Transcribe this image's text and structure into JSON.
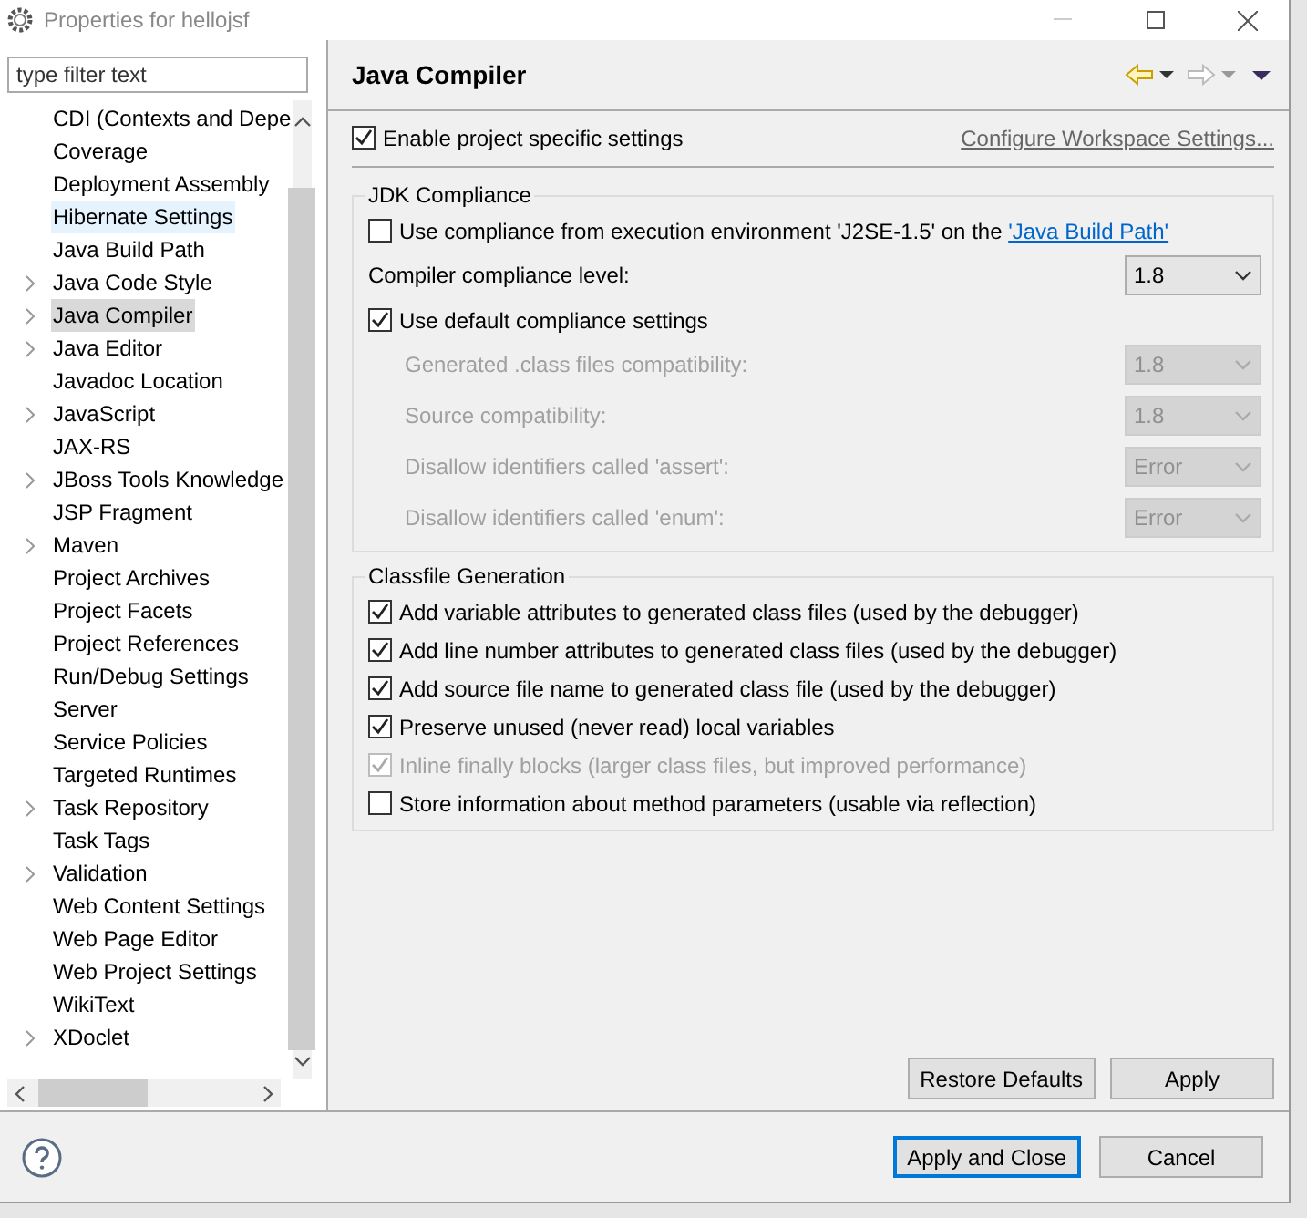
{
  "window": {
    "title": "Properties for hellojsf"
  },
  "filter": {
    "placeholder": "type filter text"
  },
  "tree": [
    {
      "label": "CDI (Contexts and Depe",
      "expandable": false,
      "selected": false,
      "hovered": false
    },
    {
      "label": "Coverage",
      "expandable": false,
      "selected": false,
      "hovered": false
    },
    {
      "label": "Deployment Assembly",
      "expandable": false,
      "selected": false,
      "hovered": false
    },
    {
      "label": "Hibernate Settings",
      "expandable": false,
      "selected": false,
      "hovered": true
    },
    {
      "label": "Java Build Path",
      "expandable": false,
      "selected": false,
      "hovered": false
    },
    {
      "label": "Java Code Style",
      "expandable": true,
      "selected": false,
      "hovered": false
    },
    {
      "label": "Java Compiler",
      "expandable": true,
      "selected": true,
      "hovered": false
    },
    {
      "label": "Java Editor",
      "expandable": true,
      "selected": false,
      "hovered": false
    },
    {
      "label": "Javadoc Location",
      "expandable": false,
      "selected": false,
      "hovered": false
    },
    {
      "label": "JavaScript",
      "expandable": true,
      "selected": false,
      "hovered": false
    },
    {
      "label": "JAX-RS",
      "expandable": false,
      "selected": false,
      "hovered": false
    },
    {
      "label": "JBoss Tools Knowledge",
      "expandable": true,
      "selected": false,
      "hovered": false
    },
    {
      "label": "JSP Fragment",
      "expandable": false,
      "selected": false,
      "hovered": false
    },
    {
      "label": "Maven",
      "expandable": true,
      "selected": false,
      "hovered": false
    },
    {
      "label": "Project Archives",
      "expandable": false,
      "selected": false,
      "hovered": false
    },
    {
      "label": "Project Facets",
      "expandable": false,
      "selected": false,
      "hovered": false
    },
    {
      "label": "Project References",
      "expandable": false,
      "selected": false,
      "hovered": false
    },
    {
      "label": "Run/Debug Settings",
      "expandable": false,
      "selected": false,
      "hovered": false
    },
    {
      "label": "Server",
      "expandable": false,
      "selected": false,
      "hovered": false
    },
    {
      "label": "Service Policies",
      "expandable": false,
      "selected": false,
      "hovered": false
    },
    {
      "label": "Targeted Runtimes",
      "expandable": false,
      "selected": false,
      "hovered": false
    },
    {
      "label": "Task Repository",
      "expandable": true,
      "selected": false,
      "hovered": false
    },
    {
      "label": "Task Tags",
      "expandable": false,
      "selected": false,
      "hovered": false
    },
    {
      "label": "Validation",
      "expandable": true,
      "selected": false,
      "hovered": false
    },
    {
      "label": "Web Content Settings",
      "expandable": false,
      "selected": false,
      "hovered": false
    },
    {
      "label": "Web Page Editor",
      "expandable": false,
      "selected": false,
      "hovered": false
    },
    {
      "label": "Web Project Settings",
      "expandable": false,
      "selected": false,
      "hovered": false
    },
    {
      "label": "WikiText",
      "expandable": false,
      "selected": false,
      "hovered": false
    },
    {
      "label": "XDoclet",
      "expandable": true,
      "selected": false,
      "hovered": false
    }
  ],
  "page": {
    "title": "Java Compiler",
    "enable": {
      "label": "Enable project specific settings",
      "checked": true
    },
    "workspace_link": "Configure Workspace Settings...",
    "groups": [
      {
        "title": "JDK Compliance",
        "rows": [
          {
            "kind": "checkbox",
            "label": "Use compliance from execution environment 'J2SE-1.5' on the ",
            "link": "'Java Build Path'",
            "checked": false,
            "disabled": false,
            "indented": false
          },
          {
            "kind": "select",
            "label": "Compiler compliance level:",
            "value": "1.8",
            "disabled": false,
            "indented": false
          },
          {
            "kind": "checkbox",
            "label": "Use default compliance settings",
            "checked": true,
            "disabled": false,
            "indented": false
          },
          {
            "kind": "select",
            "label": "Generated .class files compatibility:",
            "value": "1.8",
            "disabled": true,
            "indented": true
          },
          {
            "kind": "select",
            "label": "Source compatibility:",
            "value": "1.8",
            "disabled": true,
            "indented": true
          },
          {
            "kind": "select",
            "label": "Disallow identifiers called 'assert':",
            "value": "Error",
            "disabled": true,
            "indented": true
          },
          {
            "kind": "select",
            "label": "Disallow identifiers called 'enum':",
            "value": "Error",
            "disabled": true,
            "indented": true
          }
        ]
      },
      {
        "title": "Classfile Generation",
        "rows": [
          {
            "kind": "checkbox",
            "label": "Add variable attributes to generated class files (used by the debugger)",
            "checked": true,
            "disabled": false,
            "indented": false
          },
          {
            "kind": "checkbox",
            "label": "Add line number attributes to generated class files (used by the debugger)",
            "checked": true,
            "disabled": false,
            "indented": false
          },
          {
            "kind": "checkbox",
            "label": "Add source file name to generated class file (used by the debugger)",
            "checked": true,
            "disabled": false,
            "indented": false
          },
          {
            "kind": "checkbox",
            "label": "Preserve unused (never read) local variables",
            "checked": true,
            "disabled": false,
            "indented": false
          },
          {
            "kind": "checkbox",
            "label": "Inline finally blocks (larger class files, but improved performance)",
            "checked": true,
            "disabled": true,
            "indented": false
          },
          {
            "kind": "checkbox",
            "label": "Store information about method parameters (usable via reflection)",
            "checked": false,
            "disabled": false,
            "indented": false
          }
        ]
      }
    ]
  },
  "page_buttons": [
    {
      "label": "Restore Defaults"
    },
    {
      "label": "Apply"
    }
  ],
  "dialog_buttons": [
    {
      "label": "Apply and Close",
      "default": true
    },
    {
      "label": "Cancel",
      "default": false
    }
  ]
}
